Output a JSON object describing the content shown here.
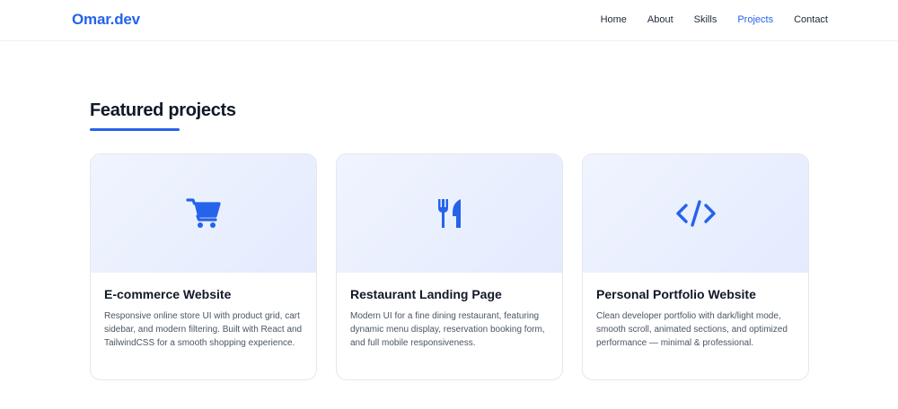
{
  "nav": {
    "brand": "Omar.dev",
    "links": [
      {
        "label": "Home",
        "active": false
      },
      {
        "label": "About",
        "active": false
      },
      {
        "label": "Skills",
        "active": false
      },
      {
        "label": "Projects",
        "active": true
      },
      {
        "label": "Contact",
        "active": false
      }
    ]
  },
  "section": {
    "title": "Featured projects"
  },
  "projects": [
    {
      "icon": "cart-icon",
      "title": "E-commerce Website",
      "description": "Responsive online store UI with product grid, cart sidebar, and modern filtering. Built with React and TailwindCSS for a smooth shopping experience."
    },
    {
      "icon": "utensils-icon",
      "title": "Restaurant Landing Page",
      "description": "Modern UI for a fine dining restaurant, featuring dynamic menu display, reservation booking form, and full mobile responsiveness."
    },
    {
      "icon": "code-icon",
      "title": "Personal Portfolio Website",
      "description": "Clean developer portfolio with dark/light mode, smooth scroll, animated sections, and optimized performance — minimal & professional."
    }
  ],
  "colors": {
    "accent": "#2563eb",
    "heading": "#111827",
    "body_text": "#4b5563",
    "card_border": "#e5e7eb"
  }
}
